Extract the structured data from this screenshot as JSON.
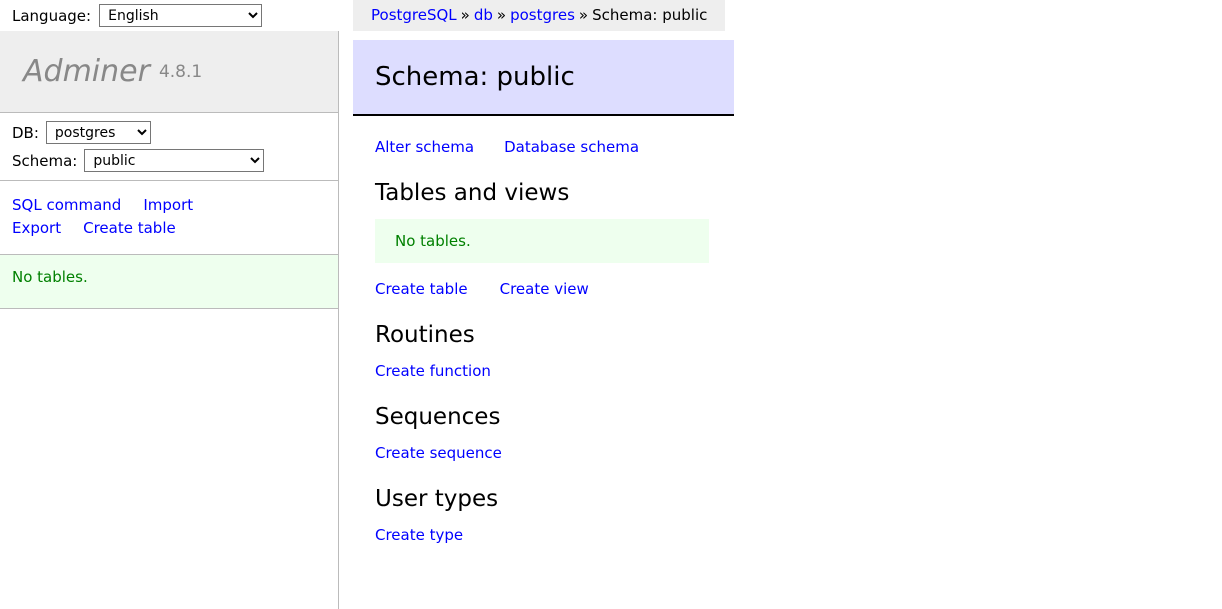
{
  "language_bar": {
    "label": "Language:",
    "selected": "English",
    "options": [
      "English"
    ]
  },
  "sidebar": {
    "brand": {
      "name": "Adminer",
      "version": "4.8.1"
    },
    "db": {
      "label": "DB:",
      "selected": "postgres",
      "options": [
        "postgres"
      ]
    },
    "schema": {
      "label": "Schema:",
      "selected": "public",
      "options": [
        "public"
      ]
    },
    "menu_links": [
      "SQL command",
      "Import",
      "Export",
      "Create table"
    ],
    "message": "No tables."
  },
  "breadcrumb": {
    "items": [
      "PostgreSQL",
      "db",
      "postgres"
    ],
    "separator": "»",
    "current": "Schema: public"
  },
  "main": {
    "heading": "Schema: public",
    "top_links": [
      "Alter schema",
      "Database schema"
    ],
    "sections": [
      {
        "title": "Tables and views",
        "message": "No tables.",
        "links": [
          "Create table",
          "Create view"
        ]
      },
      {
        "title": "Routines",
        "links": [
          "Create function"
        ]
      },
      {
        "title": "Sequences",
        "links": [
          "Create sequence"
        ]
      },
      {
        "title": "User types",
        "links": [
          "Create type"
        ]
      }
    ]
  },
  "colors": {
    "link": "#0000ff",
    "heading_bg": "#ddddff",
    "success_bg": "#eeffee",
    "success_text": "#008000",
    "panel_bg": "#eeeeee"
  }
}
